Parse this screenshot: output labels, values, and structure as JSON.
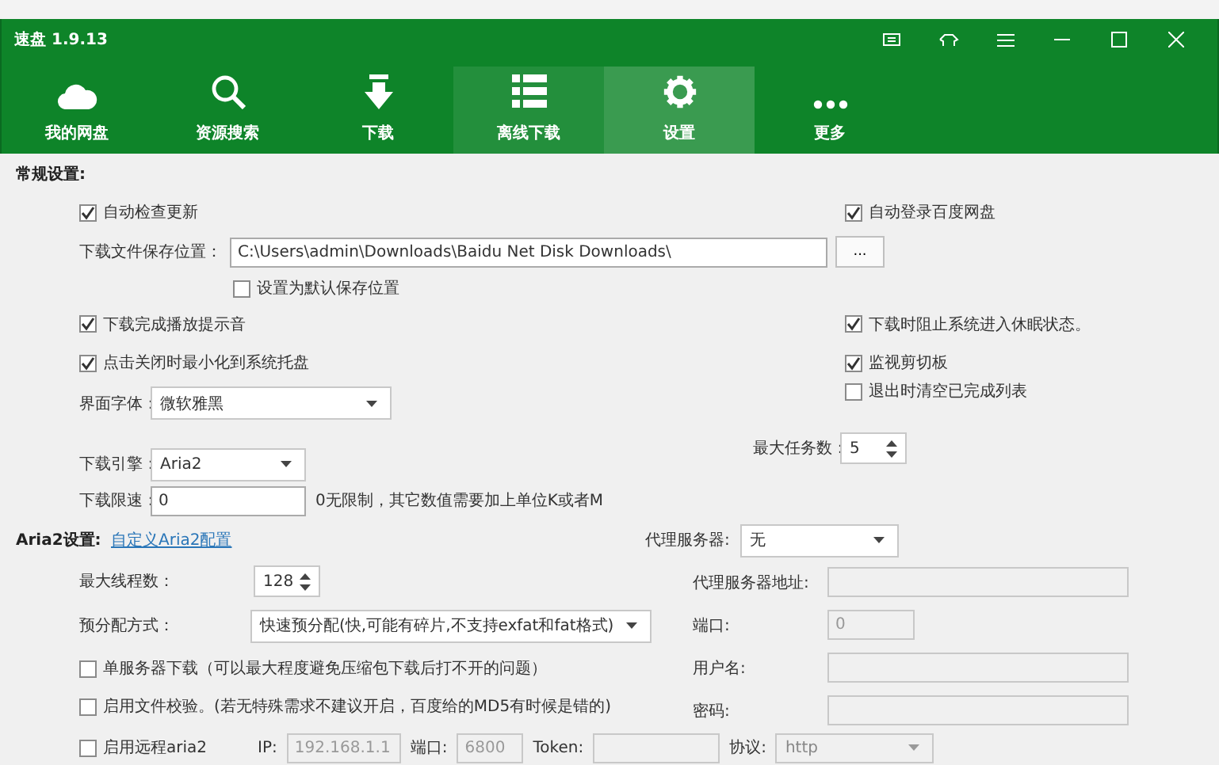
{
  "window": {
    "title": "速盘 1.9.13"
  },
  "nav": [
    {
      "label": "我的网盘",
      "selected": false,
      "hover": false
    },
    {
      "label": "资源搜索",
      "selected": false,
      "hover": false
    },
    {
      "label": "下载",
      "selected": false,
      "hover": false
    },
    {
      "label": "离线下载",
      "selected": false,
      "hover": true
    },
    {
      "label": "设置",
      "selected": true,
      "hover": false
    },
    {
      "label": "更多",
      "selected": false,
      "hover": false
    }
  ],
  "general": {
    "heading": "常规设置:",
    "auto_check_update": {
      "label": "自动检查更新",
      "checked": true
    },
    "auto_login": {
      "label": "自动登录百度网盘",
      "checked": true
    },
    "save_path": {
      "label": "下载文件保存位置：",
      "value": "C:\\Users\\admin\\Downloads\\Baidu Net Disk Downloads\\",
      "browse": "..."
    },
    "set_default": {
      "label": "设置为默认保存位置",
      "checked": false
    },
    "play_sound": {
      "label": "下载完成播放提示音",
      "checked": true
    },
    "prevent_sleep": {
      "label": "下载时阻止系统进入休眠状态。",
      "checked": true
    },
    "minimize_tray": {
      "label": "点击关闭时最小化到系统托盘",
      "checked": true
    },
    "monitor_clipboard": {
      "label": "监视剪切板",
      "checked": true
    },
    "clear_on_exit": {
      "label": "退出时清空已完成列表",
      "checked": false
    },
    "font": {
      "label": "界面字体：",
      "value": "微软雅黑"
    },
    "max_tasks": {
      "label": "最大任务数：",
      "value": "5"
    },
    "engine": {
      "label": "下载引擎：",
      "value": "Aria2"
    },
    "speed_limit": {
      "label": "下载限速：",
      "value": "0",
      "hint": "0无限制，其它数值需要加上单位K或者M"
    }
  },
  "aria2": {
    "heading": "Aria2设置:",
    "link": "自定义Aria2配置",
    "max_threads": {
      "label": "最大线程数：",
      "value": "128"
    },
    "prealloc": {
      "label": "预分配方式：",
      "value": "快速预分配(快,可能有碎片,不支持exfat和fat格式)"
    },
    "single_server": {
      "label": "单服务器下载（可以最大程度避免压缩包下载后打不开的问题）",
      "checked": false
    },
    "verify": {
      "label": "启用文件校验。(若无特殊需求不建议开启，百度给的MD5有时候是错的)",
      "checked": false
    },
    "remote": {
      "label": "启用远程aria2",
      "checked": false,
      "disabled": true,
      "ip_label": "IP:",
      "ip": "192.168.1.1",
      "port_label": "端口:",
      "port": "6800",
      "token_label": "Token:",
      "protocol_label": "协议:",
      "protocol": "http"
    }
  },
  "proxy": {
    "label": "代理服务器:",
    "value": "无",
    "fields": [
      {
        "label": "代理服务器地址:",
        "kind": "wide",
        "disabled": true
      },
      {
        "label": "端口:",
        "value": "0",
        "kind": "short",
        "disabled": true
      },
      {
        "label": "用户名:",
        "kind": "wide",
        "disabled": true
      },
      {
        "label": "密码:",
        "kind": "wide",
        "disabled": true
      }
    ]
  }
}
